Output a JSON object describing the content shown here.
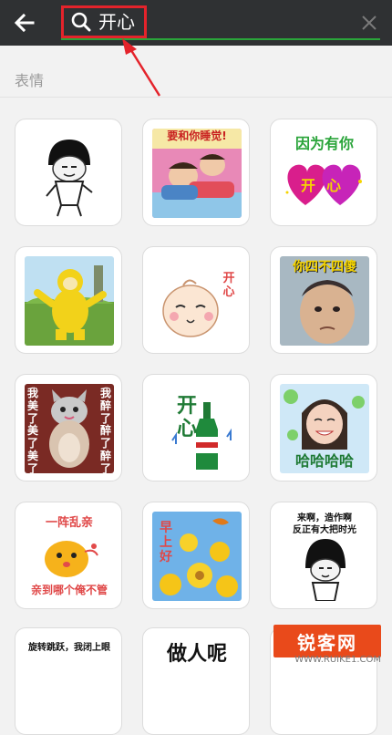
{
  "header": {
    "back_icon": "back-arrow-icon",
    "search_icon": "search-icon",
    "search_query": "开心",
    "clear_icon": "close-icon",
    "highlight_color": "#e4232b",
    "accent_color": "#2aa43a"
  },
  "section": {
    "title": "表情"
  },
  "stickers": [
    {
      "id": 1,
      "caption": ""
    },
    {
      "id": 2,
      "caption": "要和你睡觉!"
    },
    {
      "id": 3,
      "caption": "因为有你",
      "caption2": "开心"
    },
    {
      "id": 4,
      "caption": ""
    },
    {
      "id": 5,
      "caption": "开心"
    },
    {
      "id": 6,
      "caption": "你四不四傻"
    },
    {
      "id": 7,
      "caption": "我美了美了美了",
      "caption2": "我醉了醉了醉了"
    },
    {
      "id": 8,
      "caption": "开心"
    },
    {
      "id": 9,
      "caption": "哈哈哈哈"
    },
    {
      "id": 10,
      "caption": "一阵乱亲",
      "caption2": "亲到哪个俺不管"
    },
    {
      "id": 11,
      "caption": "早上好"
    },
    {
      "id": 12,
      "caption": "来啊，造作啊",
      "caption2": "反正有大把时光"
    },
    {
      "id": 13,
      "caption": "旋转跳跃，我闭上眼"
    },
    {
      "id": 14,
      "caption": "做人呢"
    },
    {
      "id": 15,
      "caption": ""
    }
  ],
  "watermark": {
    "text": "锐客网",
    "url": "WWW.RUIKE1.COM"
  }
}
